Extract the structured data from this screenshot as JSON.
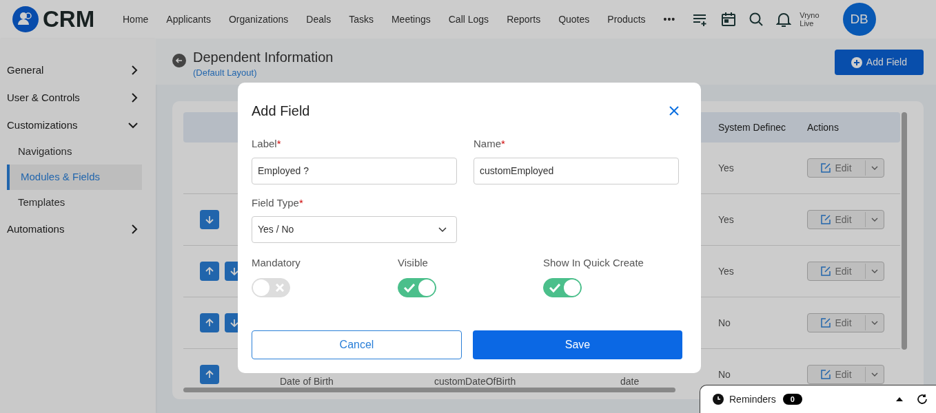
{
  "header": {
    "logo": "CRM",
    "nav": [
      {
        "label": "Home"
      },
      {
        "label": "Applicants"
      },
      {
        "label": "Organizations"
      },
      {
        "label": "Deals"
      },
      {
        "label": "Tasks"
      },
      {
        "label": "Meetings"
      },
      {
        "label": "Call Logs"
      },
      {
        "label": "Reports"
      },
      {
        "label": "Quotes"
      },
      {
        "label": "Products"
      }
    ],
    "more": "•••",
    "user": {
      "line1": "Vryno",
      "line2": "Live",
      "initials": "DB"
    }
  },
  "sidebar": {
    "items": [
      {
        "label": "General",
        "expanded": false
      },
      {
        "label": "User & Controls",
        "expanded": false
      },
      {
        "label": "Customizations",
        "expanded": true,
        "children": [
          {
            "label": "Navigations",
            "selected": false
          },
          {
            "label": "Modules & Fields",
            "selected": true
          },
          {
            "label": "Templates",
            "selected": false
          }
        ]
      },
      {
        "label": "Automations",
        "expanded": false
      }
    ]
  },
  "page": {
    "title": "Dependent Information",
    "subtitle": "(Default Layout)",
    "add_button": "Add Field"
  },
  "table": {
    "columns": [
      "System Definec",
      "Actions"
    ],
    "rows": [
      {
        "arrows": [],
        "cells": [
          "",
          "",
          ""
        ],
        "system_defined": "Yes",
        "action": "Edit"
      },
      {
        "arrows": [
          {
            "kind": "down"
          }
        ],
        "cells": [
          "",
          "",
          ""
        ],
        "system_defined": "Yes",
        "action": "Edit"
      },
      {
        "arrows": [
          {
            "kind": "up"
          },
          {
            "kind": "down"
          }
        ],
        "cells": [
          "",
          "",
          ""
        ],
        "system_defined": "Yes",
        "action": "Edit"
      },
      {
        "arrows": [
          {
            "kind": "up"
          },
          {
            "kind": "down"
          }
        ],
        "cells": [
          "",
          "",
          ""
        ],
        "system_defined": "No",
        "action": "Edit"
      },
      {
        "arrows": [
          {
            "kind": "up"
          }
        ],
        "cells": [
          "Date of Birth",
          "customDateOfBirth",
          "date"
        ],
        "system_defined": "No",
        "action": "Edit"
      }
    ]
  },
  "dialog": {
    "title": "Add Field",
    "fields": [
      {
        "label": "Label",
        "required_mark": "*",
        "value": "Employed ?"
      },
      {
        "label": "Name",
        "required_mark": "*",
        "value": "customEmployed"
      },
      {
        "label": "Field Type",
        "required_mark": "*",
        "value": "Yes / No"
      }
    ],
    "toggles": [
      {
        "label": "Mandatory",
        "on": false
      },
      {
        "label": "Visible",
        "on": true
      },
      {
        "label": "Show In Quick Create",
        "on": true
      }
    ],
    "cancel": "Cancel",
    "save": "Save"
  },
  "reminders": {
    "label": "Reminders",
    "count": "0"
  }
}
